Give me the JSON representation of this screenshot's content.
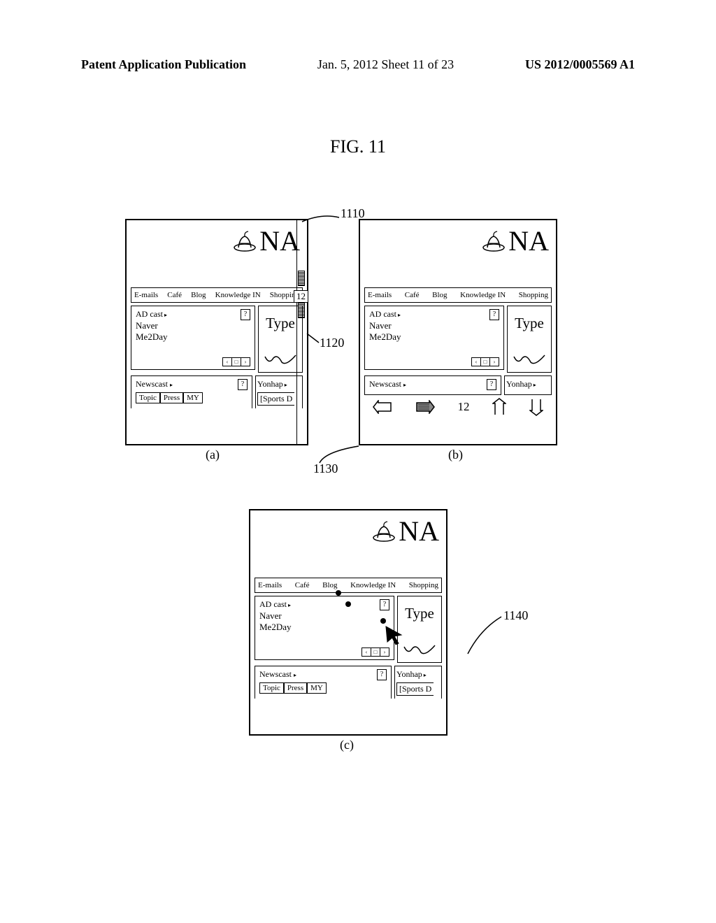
{
  "header": {
    "left": "Patent Application Publication",
    "center": "Jan. 5, 2012  Sheet 11 of 23",
    "right": "US 2012/0005569 A1"
  },
  "figureTitle": "FIG. 11",
  "refs": {
    "r1110": "1110",
    "r1120": "1120",
    "r1130": "1130",
    "r1140": "1140"
  },
  "logo": {
    "text_a": "NA",
    "text_b": "NA",
    "text_c": "NA"
  },
  "nav": {
    "items": [
      "E-mails",
      "Café",
      "Blog",
      "Knowledge IN",
      "Shopping"
    ]
  },
  "ad": {
    "title": "AD cast",
    "qmark": "?",
    "line1": "Naver",
    "line2": "Me2Day",
    "pager": [
      "‹",
      "□",
      "›"
    ]
  },
  "typeLabel": "Type",
  "news": {
    "left": "Newscast",
    "qmark": "?",
    "right": "Yonhap",
    "topic": [
      "Topic",
      "Press",
      "MY"
    ],
    "sports": "[Sports D"
  },
  "scrollNum": "12",
  "controls": {
    "pageNum": "12"
  },
  "captions": {
    "a": "(a)",
    "b": "(b)",
    "c": "(c)"
  }
}
